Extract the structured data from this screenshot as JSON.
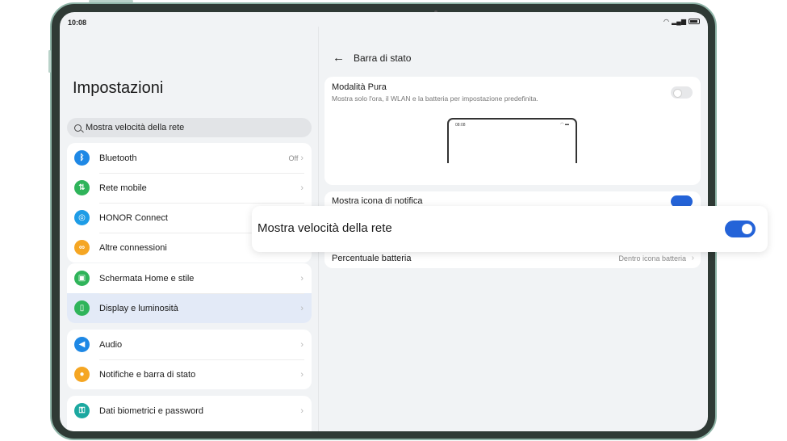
{
  "status_bar": {
    "time": "10:08",
    "wifi_icon": "wifi-icon",
    "signal_icon": "signal-icon",
    "battery_icon": "battery-icon"
  },
  "left": {
    "title": "Impostazioni",
    "search": {
      "value": "Mostra velocità della rete"
    },
    "group1": [
      {
        "icon": "bluetooth-icon",
        "color": "#1e88e5",
        "label": "Bluetooth",
        "value": "Off"
      },
      {
        "icon": "mobile-network-icon",
        "color": "#2fb45a",
        "label": "Rete mobile",
        "value": ""
      },
      {
        "icon": "honor-connect-icon",
        "color": "#1e9ce6",
        "label": "HONOR Connect",
        "value": ""
      },
      {
        "icon": "link-icon",
        "color": "#f5a623",
        "label": "Altre connessioni",
        "value": ""
      }
    ],
    "group2": [
      {
        "icon": "home-screen-icon",
        "color": "#2fb45a",
        "label": "Schermata Home e stile"
      },
      {
        "icon": "display-icon",
        "color": "#2fb45a",
        "label": "Display e luminosità"
      }
    ],
    "group3": [
      {
        "icon": "audio-icon",
        "color": "#1e88e5",
        "label": "Audio"
      },
      {
        "icon": "bell-icon",
        "color": "#f5a623",
        "label": "Notifiche e barra di stato"
      }
    ],
    "group4": [
      {
        "icon": "key-icon",
        "color": "#1ba8a0",
        "label": "Dati biometrici e password"
      }
    ]
  },
  "right": {
    "header_title": "Barra di stato",
    "pura": {
      "title": "Modalità Pura",
      "description": "Mostra solo l'ora, il WLAN e la batteria per impostazione predefinita.",
      "enabled": false,
      "preview_time": "08:08"
    },
    "notif_label": "Mostra icona di notifica",
    "notif_enabled": true,
    "battery_label": "Percentuale batteria",
    "battery_value": "Dentro icona batteria"
  },
  "highlight": {
    "label": "Mostra velocità della rete",
    "enabled": true
  },
  "colors": {
    "accent": "#2463d8",
    "selected_row": "#e3eaf7",
    "screen_bg": "#f1f3f5"
  }
}
